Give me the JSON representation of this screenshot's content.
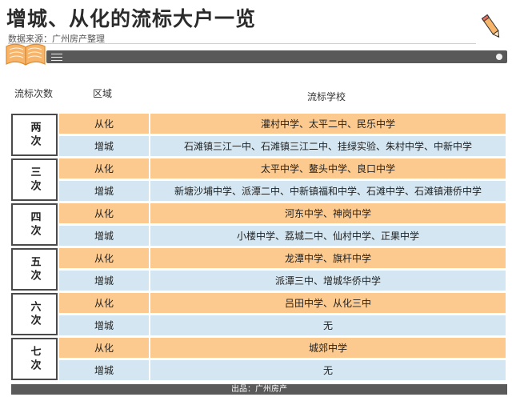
{
  "title": "增城、从化的流标大户一览",
  "source": "数据来源：广州房产整理",
  "headers": {
    "count": "流标次数",
    "district": "区域",
    "schools": "流标学校"
  },
  "groups": [
    {
      "count": "两次",
      "rows": [
        {
          "district": "从化",
          "schools": "灌村中学、太平二中、民乐中学"
        },
        {
          "district": "增城",
          "schools": "石滩镇三江一中、石滩镇三江二中、挂绿实验、朱村中学、中新中学"
        }
      ]
    },
    {
      "count": "三次",
      "rows": [
        {
          "district": "从化",
          "schools": "太平中学、鳌头中学、良口中学"
        },
        {
          "district": "增城",
          "schools": "新塘沙埔中学、派潭二中、中新镇福和中学、石滩中学、石滩镇港侨中学"
        }
      ]
    },
    {
      "count": "四次",
      "rows": [
        {
          "district": "从化",
          "schools": "河东中学、神岗中学"
        },
        {
          "district": "增城",
          "schools": "小楼中学、荔城二中、仙村中学、正果中学"
        }
      ]
    },
    {
      "count": "五次",
      "rows": [
        {
          "district": "从化",
          "schools": "龙潭中学、旗杆中学"
        },
        {
          "district": "增城",
          "schools": "派潭三中、增城华侨中学"
        }
      ]
    },
    {
      "count": "六次",
      "rows": [
        {
          "district": "从化",
          "schools": "吕田中学、从化三中"
        },
        {
          "district": "增城",
          "schools": "无"
        }
      ]
    },
    {
      "count": "七次",
      "rows": [
        {
          "district": "从化",
          "schools": "城郊中学"
        },
        {
          "district": "增城",
          "schools": "无"
        }
      ]
    }
  ],
  "footer": "出品：广州房产",
  "colors": {
    "orange_row": "#fcc98e",
    "blue_row": "#d3e6f1",
    "bar": "#595959"
  },
  "icons": {
    "book": "open-book-icon",
    "pencil": "pencil-icon",
    "menu": "menu-icon",
    "dot": "dot-icon"
  }
}
